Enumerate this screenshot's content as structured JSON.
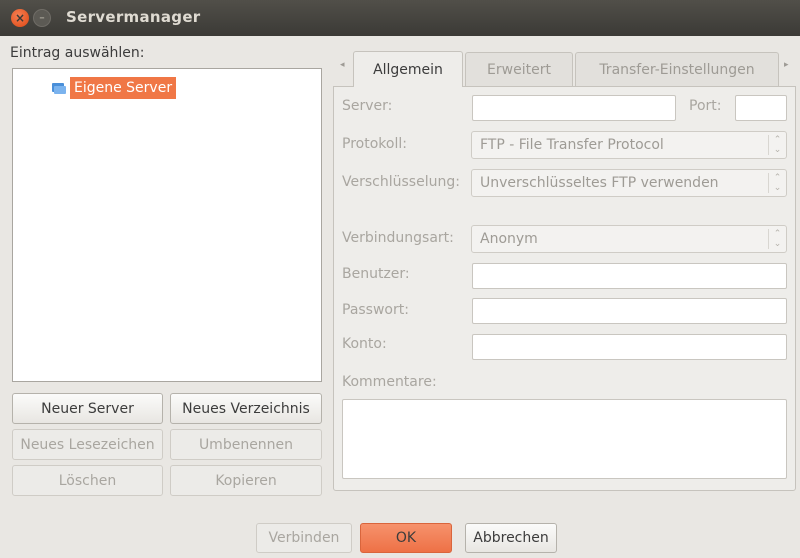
{
  "window": {
    "title": "Servermanager",
    "close_glyph": "×",
    "min_glyph": "–"
  },
  "left": {
    "select_label": "Eintrag auswählen:",
    "tree": {
      "items": [
        {
          "label": "Eigene Server",
          "icon": "server-folder-icon",
          "selected": true
        }
      ]
    },
    "buttons": {
      "new_server": "Neuer Server",
      "new_folder": "Neues Verzeichnis",
      "new_bookmark": "Neues Lesezeichen",
      "rename": "Umbenennen",
      "delete": "Löschen",
      "copy": "Kopieren"
    }
  },
  "tabs": {
    "left_arrow": "◂",
    "right_arrow": "▸",
    "items": [
      "Allgemein",
      "Erweitert",
      "Transfer-Einstellungen"
    ],
    "active_index": 0
  },
  "general": {
    "server_label": "Server:",
    "server_value": "",
    "port_label": "Port:",
    "port_value": "",
    "protocol_label": "Protokoll:",
    "protocol_value": "FTP - File Transfer Protocol",
    "encryption_label": "Verschlüsselung:",
    "encryption_value": "Unverschlüsseltes FTP verwenden",
    "logon_label": "Verbindungsart:",
    "logon_value": "Anonym",
    "user_label": "Benutzer:",
    "user_value": "",
    "password_label": "Passwort:",
    "password_value": "",
    "account_label": "Konto:",
    "account_value": "",
    "comments_label": "Kommentare:",
    "comments_value": ""
  },
  "footer": {
    "connect": "Verbinden",
    "ok": "OK",
    "cancel": "Abbrechen"
  },
  "colors": {
    "selection": "#f07746",
    "ok_button": "#ee7146",
    "titlebar": "#3b3a36"
  }
}
